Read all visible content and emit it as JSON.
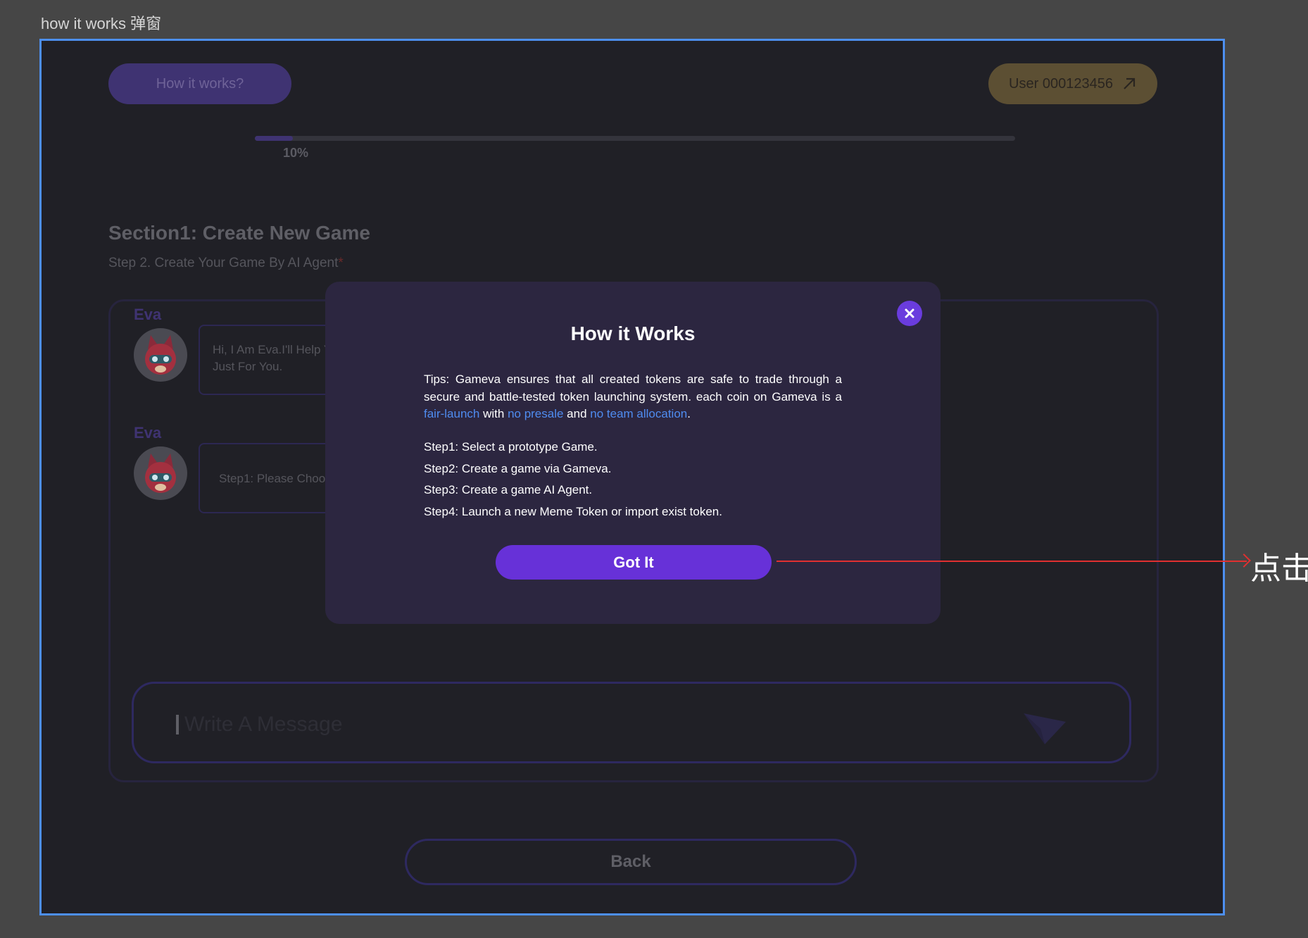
{
  "canvas_label": "how it works 弹窗",
  "header": {
    "how_it_works_label": "How it works?",
    "user_label": "User 000123456"
  },
  "progress": {
    "value": 0.05,
    "label": "10%"
  },
  "section": {
    "title": "Section1: Create New Game",
    "subtitle": "Step 2. Create Your Game By AI Agent",
    "required_mark": "*"
  },
  "messages": [
    {
      "name": "Eva",
      "text": "Hi, I Am Eva.I'll Help Y\nJust For You."
    },
    {
      "name": "Eva",
      "text": "Step1: Please Choos"
    }
  ],
  "input": {
    "placeholder": "Write A Message"
  },
  "back_label": "Back",
  "modal": {
    "title": "How it Works",
    "tips_prefix": "Tips: Gameva ensures that all created tokens are safe to trade through a secure and battle-tested token launching system. each coin on Gameva is a ",
    "tips_link1": "fair-launch",
    "tips_mid1": " with ",
    "tips_link2": "no presale",
    "tips_mid2": " and ",
    "tips_link3": "no team allocation",
    "tips_end": ".",
    "steps": [
      "Step1: Select a prototype Game.",
      "Step2: Create a game via Gameva.",
      "Step3: Create a game AI Agent.",
      "Step4: Launch a new Meme Token or import exist token."
    ],
    "button_label": "Got It"
  },
  "annotation": {
    "text": "点击"
  },
  "colors": {
    "accent": "#6731d8",
    "link": "#4f8cf0",
    "modal_bg": "#2c2640",
    "frame_border": "#4d8ff0",
    "annotation": "#e03030"
  }
}
